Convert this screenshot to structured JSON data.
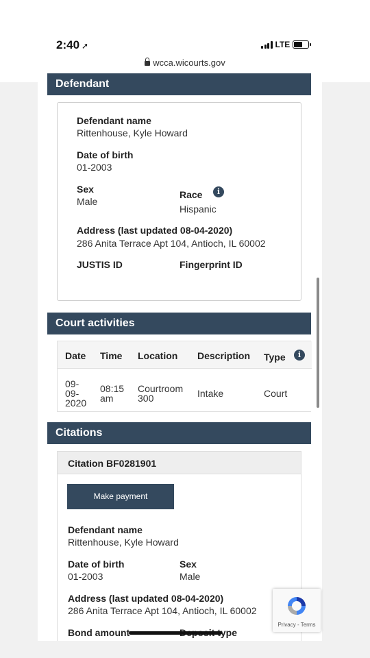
{
  "status_bar": {
    "time": "2:40",
    "network": "LTE"
  },
  "browser": {
    "url": "wcca.wicourts.gov"
  },
  "defendant": {
    "header": "Defendant",
    "name_label": "Defendant name",
    "name": "Rittenhouse, Kyle Howard",
    "dob_label": "Date of birth",
    "dob": "01-2003",
    "sex_label": "Sex",
    "sex": "Male",
    "race_label": "Race",
    "race": "Hispanic",
    "address_label": "Address (last updated 08-04-2020)",
    "address": "286 Anita Terrace Apt 104, Antioch, IL 60002",
    "justis_label": "JUSTIS ID",
    "fingerprint_label": "Fingerprint ID"
  },
  "court_activities": {
    "header": "Court activities",
    "columns": [
      "Date",
      "Time",
      "Location",
      "Description",
      "Type"
    ],
    "rows": [
      {
        "date": "09-09-2020",
        "date_lines": [
          "09-",
          "09-",
          "2020"
        ],
        "time_lines": [
          "08:15",
          "am"
        ],
        "location_lines": [
          "Courtroom",
          "300"
        ],
        "description": "Intake",
        "type": "Court"
      }
    ]
  },
  "citations": {
    "header": "Citations",
    "citation_title": "Citation BF0281901",
    "pay_button": "Make payment",
    "name_label": "Defendant name",
    "name": "Rittenhouse, Kyle Howard",
    "dob_label": "Date of birth",
    "dob": "01-2003",
    "sex_label": "Sex",
    "sex": "Male",
    "address_label": "Address (last updated 08-04-2020)",
    "address": "286 Anita Terrace Apt 104, Antioch, IL 60002",
    "bond_label": "Bond amount",
    "deposit_label": "Deposit type"
  },
  "recaptcha": {
    "terms": "Privacy - Terms"
  }
}
